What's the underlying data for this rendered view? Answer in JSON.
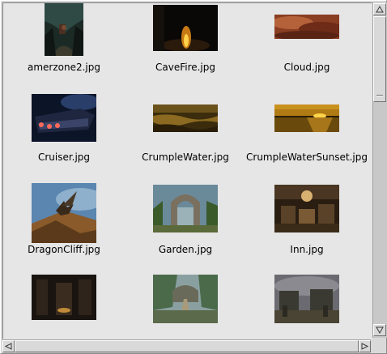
{
  "files": [
    {
      "name": "amerzone2.jpg"
    },
    {
      "name": "CaveFire.jpg"
    },
    {
      "name": "Cloud.jpg"
    },
    {
      "name": "Cruiser.jpg"
    },
    {
      "name": "CrumpleWater.jpg"
    },
    {
      "name": "CrumpleWaterSunset.jpg"
    },
    {
      "name": "DragonCliff.jpg"
    },
    {
      "name": "Garden.jpg"
    },
    {
      "name": "Inn.jpg"
    },
    {
      "name": ""
    },
    {
      "name": ""
    },
    {
      "name": ""
    }
  ],
  "scrollbars": {
    "vertical": {
      "up_icon": "arrow-up-icon",
      "down_icon": "arrow-down-icon",
      "position": 0.0
    },
    "horizontal": {
      "left_icon": "arrow-left-icon",
      "right_icon": "arrow-right-icon",
      "position": 0.0
    }
  },
  "colors": {
    "background": "#e6e6e6",
    "chrome": "#d9d9d9"
  }
}
